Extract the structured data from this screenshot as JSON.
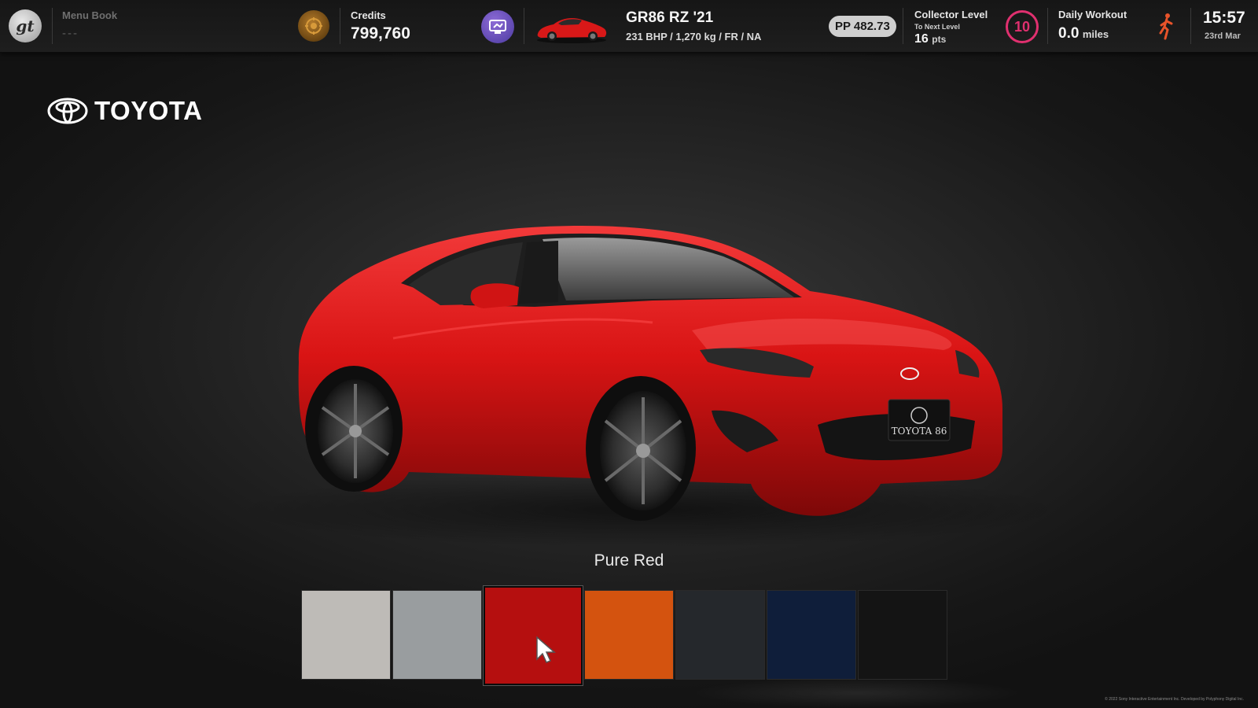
{
  "header": {
    "menu_book": {
      "title": "Menu Book",
      "value": "---"
    },
    "credits": {
      "label": "Credits",
      "value": "799,760"
    },
    "car": {
      "name": "GR86 RZ '21",
      "specs": "231 BHP / 1,270 kg / FR / NA"
    },
    "pp": "PP 482.73",
    "collector": {
      "title": "Collector Level",
      "to_next": "To Next Level",
      "points": "16",
      "points_unit": "pts",
      "level": "10"
    },
    "workout": {
      "title": "Daily Workout",
      "value": "0.0",
      "unit": "miles"
    },
    "clock": {
      "time": "15:57",
      "date": "23rd Mar"
    }
  },
  "brand": {
    "name": "TOYOTA"
  },
  "car_plate": "TOYOTA 86",
  "color_picker": {
    "selected_name": "Pure Red",
    "selected_index": 2,
    "swatches": [
      {
        "color": "#bebbb7"
      },
      {
        "color": "#999d9f"
      },
      {
        "color": "#b50f0f"
      },
      {
        "color": "#d4530f"
      },
      {
        "color": "#25282c"
      },
      {
        "color": "#0f1e3a"
      },
      {
        "color": "#141414"
      }
    ]
  },
  "footer": {
    "copyright": "© 2022 Sony Interactive Entertainment Inc. Developed by Polyphony Digital Inc."
  },
  "colors": {
    "accent_pink": "#e0306f",
    "runner_orange": "#e8532a",
    "car_red": "#d61414"
  },
  "icons": {
    "gt_logo": "gt-logo-icon",
    "credits": "credits-coin-icon",
    "garage": "garage-icon",
    "runner": "runner-icon",
    "cursor": "cursor-arrow-icon"
  }
}
